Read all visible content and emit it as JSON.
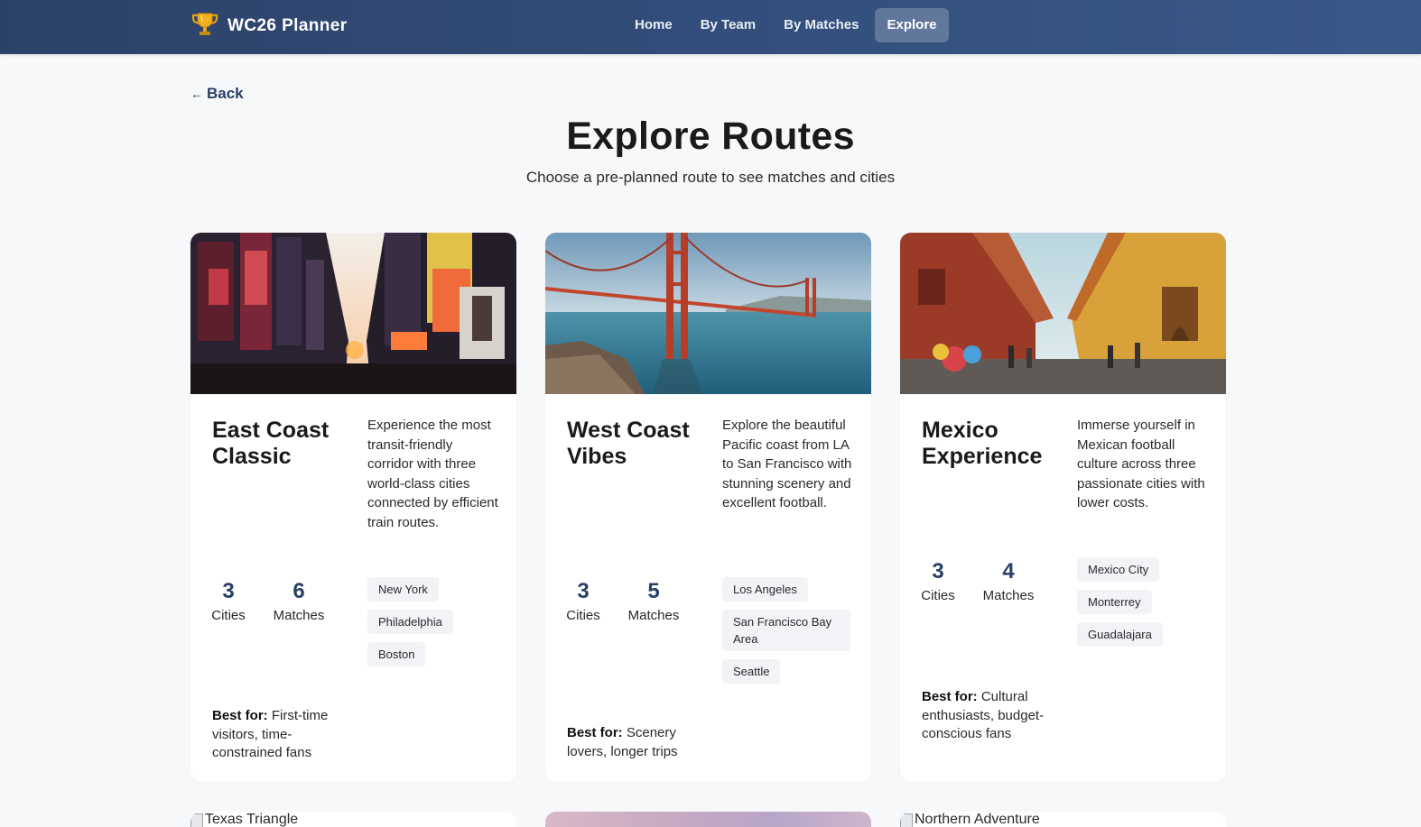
{
  "header": {
    "brand": "WC26 Planner",
    "nav": [
      {
        "label": "Home",
        "active": false
      },
      {
        "label": "By Team",
        "active": false
      },
      {
        "label": "By Matches",
        "active": false
      },
      {
        "label": "Explore",
        "active": true
      }
    ]
  },
  "back_label": "Back",
  "page": {
    "title": "Explore Routes",
    "subtitle": "Choose a pre-planned route to see matches and cities"
  },
  "routes": [
    {
      "title": "East Coast Classic",
      "description": "Experience the most transit-friendly corridor with three world-class cities connected by efficient train routes.",
      "cities_count": "3",
      "cities_label": "Cities",
      "matches_count": "6",
      "matches_label": "Matches",
      "cities": [
        "New York",
        "Philadelphia",
        "Boston"
      ],
      "best_for_label": "Best for:",
      "best_for": "First-time visitors, time-constrained fans",
      "image": "times-square-photo"
    },
    {
      "title": "West Coast Vibes",
      "description": "Explore the beautiful Pacific coast from LA to San Francisco with stunning scenery and excellent football.",
      "cities_count": "3",
      "cities_label": "Cities",
      "matches_count": "5",
      "matches_label": "Matches",
      "cities": [
        "Los Angeles",
        "San Francisco Bay Area",
        "Seattle"
      ],
      "best_for_label": "Best for:",
      "best_for": "Scenery lovers, longer trips",
      "image": "golden-gate-bridge-photo"
    },
    {
      "title": "Mexico Experience",
      "description": "Immerse yourself in Mexican football culture across three passionate cities with lower costs.",
      "cities_count": "3",
      "cities_label": "Cities",
      "matches_count": "4",
      "matches_label": "Matches",
      "cities": [
        "Mexico City",
        "Monterrey",
        "Guadalajara"
      ],
      "best_for_label": "Best for:",
      "best_for": "Cultural enthusiasts, budget-conscious fans",
      "image": "mexican-street-photo"
    }
  ],
  "more_routes": [
    {
      "image_alt": "Texas Triangle",
      "broken": true
    },
    {
      "image_alt": "",
      "broken": false
    },
    {
      "image_alt": "Northern Adventure",
      "broken": true
    }
  ],
  "colors": {
    "header_bg": "#2c4168",
    "accent": "#2a3f66",
    "page_bg": "#f7f8fa",
    "card_bg": "#ffffff"
  }
}
